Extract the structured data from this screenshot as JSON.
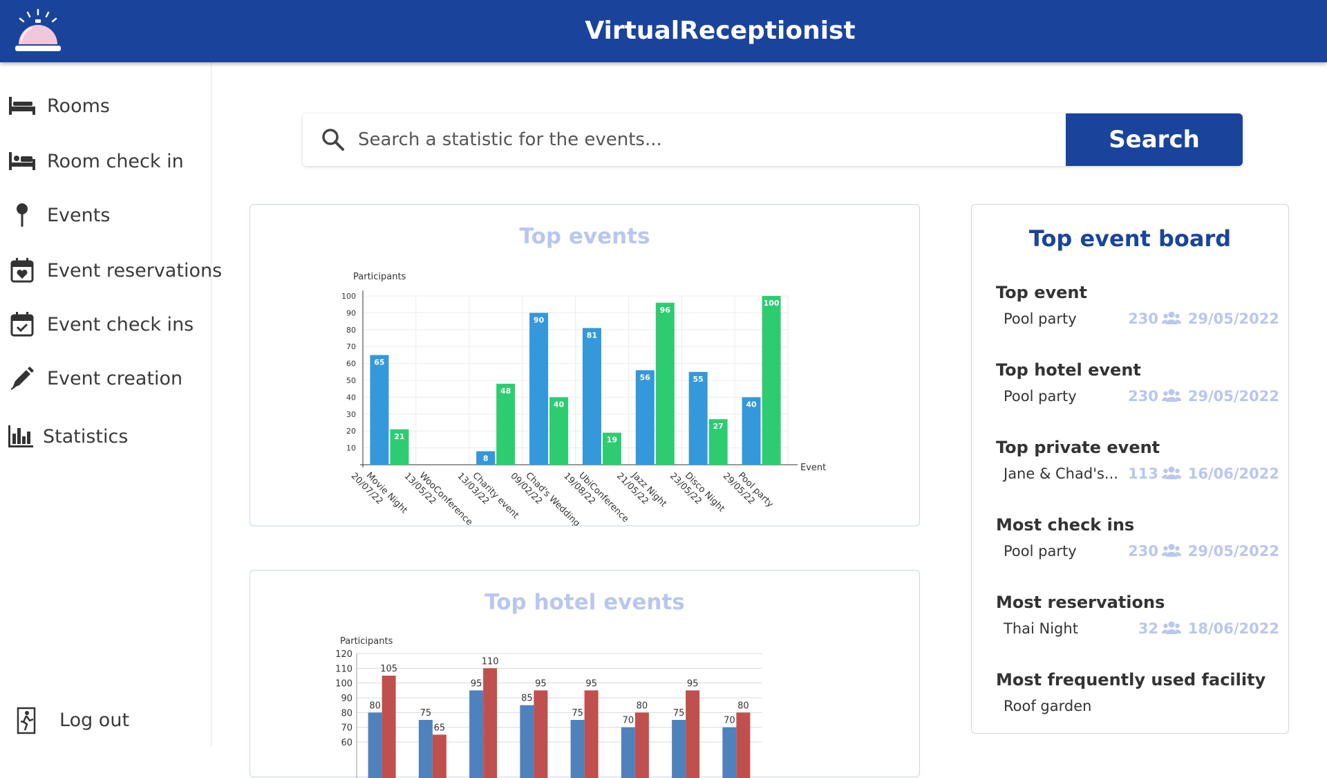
{
  "app": {
    "title": "VirtualReceptionist",
    "logo_icon": "reception-bell-icon",
    "brand_color": "#1a449c"
  },
  "sidebar": {
    "items": [
      {
        "label": "Rooms",
        "icon": "bed-icon"
      },
      {
        "label": "Room check in",
        "icon": "bed-person-icon"
      },
      {
        "label": "Events",
        "icon": "pin-icon"
      },
      {
        "label": "Event reservations",
        "icon": "calendar-heart-icon"
      },
      {
        "label": "Event check ins",
        "icon": "calendar-check-icon"
      },
      {
        "label": "Event creation",
        "icon": "pen-icon"
      },
      {
        "label": "Statistics",
        "icon": "bar-chart-icon"
      }
    ],
    "logout": {
      "label": "Log out",
      "icon": "exit-icon"
    }
  },
  "search": {
    "placeholder": "Search a statistic for the events...",
    "button_label": "Search"
  },
  "chart_data": [
    {
      "type": "bar",
      "title": "Top events",
      "ylabel": "Participants",
      "xlabel": "Event",
      "ylim": [
        0,
        100
      ],
      "yticks": [
        10,
        20,
        30,
        40,
        50,
        60,
        70,
        80,
        90,
        100
      ],
      "categories": [
        [
          "Movie Night",
          "20/07/22"
        ],
        [
          "WooConference",
          "13/05/22"
        ],
        [
          "Charity event",
          "13/03/22"
        ],
        [
          "Chad's Wedding",
          "09/02/22"
        ],
        [
          "UbiConference",
          "19/08/22"
        ],
        [
          "Jazz Night",
          "21/05/22"
        ],
        [
          "Disco Night",
          "23/05/22"
        ],
        [
          "Pool party",
          "29/05/22"
        ]
      ],
      "series": [
        {
          "color": "#3498db",
          "values": [
            65,
            null,
            8,
            90,
            81,
            56,
            55,
            40
          ]
        },
        {
          "color": "#2ecc71",
          "values": [
            21,
            null,
            48,
            40,
            19,
            96,
            27,
            100
          ]
        }
      ]
    },
    {
      "type": "bar",
      "title": "Top hotel events",
      "ylabel": "Participants",
      "ylim": [
        60,
        120
      ],
      "yticks": [
        60,
        70,
        80,
        90,
        100,
        110,
        120
      ],
      "series": [
        {
          "color": "#4f81bd",
          "values": [
            80,
            75,
            95,
            85,
            75,
            70,
            75,
            70
          ]
        },
        {
          "color": "#c0504d",
          "values": [
            105,
            65,
            110,
            95,
            95,
            80,
            95,
            80
          ]
        }
      ]
    }
  ],
  "board": {
    "title": "Top event board",
    "people_icon": "people-icon",
    "sections": [
      {
        "heading": "Top event",
        "name": "Pool party",
        "count": "230",
        "date": "29/05/2022"
      },
      {
        "heading": "Top hotel event",
        "name": "Pool party",
        "count": "230",
        "date": "29/05/2022"
      },
      {
        "heading": "Top private event",
        "name": "Jane & Chad's...",
        "count": "113",
        "date": "16/06/2022"
      },
      {
        "heading": "Most check ins",
        "name": "Pool party",
        "count": "230",
        "date": "29/05/2022"
      },
      {
        "heading": "Most reservations",
        "name": "Thai Night",
        "count": "32",
        "date": "18/06/2022"
      },
      {
        "heading": "Most frequently used facility",
        "name": "Roof garden",
        "count": "",
        "date": ""
      }
    ]
  }
}
